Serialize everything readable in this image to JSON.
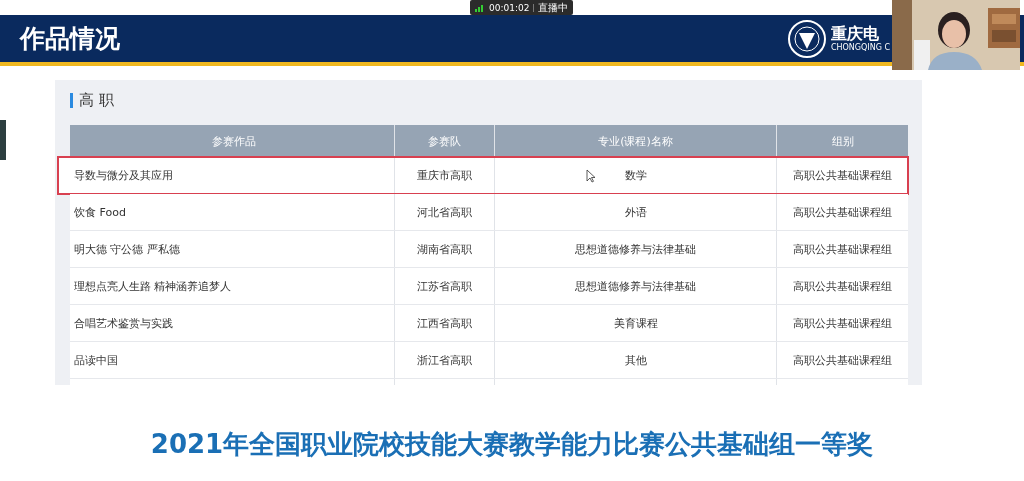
{
  "live_indicator": {
    "time": "00:01:02",
    "status": "直播中"
  },
  "slide": {
    "title": "作品情况",
    "logo_text": "重庆电",
    "logo_subtext": "CHONGQING C",
    "section_title": "高 职",
    "table": {
      "columns": [
        "参赛作品",
        "参赛队",
        "专业(课程)名称",
        "组别"
      ],
      "rows": [
        {
          "cells": [
            "导数与微分及其应用",
            "重庆市高职",
            "数学",
            "高职公共基础课程组"
          ],
          "selected": true
        },
        {
          "cells": [
            "饮食 Food",
            "河北省高职",
            "外语",
            "高职公共基础课程组"
          ],
          "selected": false
        },
        {
          "cells": [
            "明大德 守公德 严私德",
            "湖南省高职",
            "思想道德修养与法律基础",
            "高职公共基础课程组"
          ],
          "selected": false
        },
        {
          "cells": [
            "理想点亮人生路 精神涵养追梦人",
            "江苏省高职",
            "思想道德修养与法律基础",
            "高职公共基础课程组"
          ],
          "selected": false
        },
        {
          "cells": [
            "合唱艺术鉴赏与实践",
            "江西省高职",
            "美育课程",
            "高职公共基础课程组"
          ],
          "selected": false
        },
        {
          "cells": [
            "品读中国",
            "浙江省高职",
            "其他",
            "高职公共基础课程组"
          ],
          "selected": false
        }
      ]
    },
    "caption": "2021年全国职业院校技能大赛教学能力比赛公共基础组一等奖"
  }
}
